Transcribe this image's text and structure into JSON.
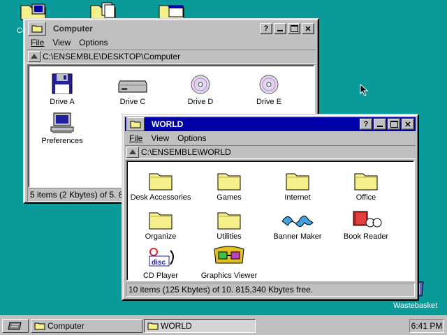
{
  "desktop": {
    "icons": [
      {
        "name": "computer-desktop-icon",
        "label": "Co"
      },
      {
        "name": "documents-desktop-icon",
        "label": ""
      },
      {
        "name": "window-desktop-icon",
        "label": ""
      }
    ],
    "wastebasket_label": "Wastebasket",
    "background_color": "#0a9a9a"
  },
  "computer_window": {
    "title": "Computer",
    "menus": [
      "File",
      "View",
      "Options"
    ],
    "path": "C:\\ENSEMBLE\\DESKTOP\\Computer",
    "items": [
      {
        "label": "Drive A",
        "icon": "floppy-drive-icon"
      },
      {
        "label": "Drive C",
        "icon": "hard-drive-icon"
      },
      {
        "label": "Drive D",
        "icon": "cd-drive-icon"
      },
      {
        "label": "Drive E",
        "icon": "cd-drive-icon"
      },
      {
        "label": "Preferences",
        "icon": "preferences-computer-icon"
      }
    ],
    "status": "5 items (2 Kbytes) of 5.  8"
  },
  "world_window": {
    "title": "WORLD",
    "menus": [
      "File",
      "View",
      "Options"
    ],
    "path": "C:\\ENSEMBLE\\WORLD",
    "items": [
      {
        "label": "Desk Accessories",
        "icon": "folder-icon"
      },
      {
        "label": "Games",
        "icon": "folder-icon"
      },
      {
        "label": "Internet",
        "icon": "folder-icon"
      },
      {
        "label": "Office",
        "icon": "folder-icon"
      },
      {
        "label": "Organize",
        "icon": "folder-icon"
      },
      {
        "label": "Utilities",
        "icon": "folder-icon"
      },
      {
        "label": "Banner Maker",
        "icon": "banner-maker-icon"
      },
      {
        "label": "Book Reader",
        "icon": "book-reader-icon"
      },
      {
        "label": "CD Player",
        "icon": "cd-player-icon"
      },
      {
        "label": "Graphics Viewer",
        "icon": "graphics-viewer-icon"
      }
    ],
    "status": "10 items (125 Kbytes) of 10.  815,340 Kbytes free."
  },
  "taskbar": {
    "tasks": [
      {
        "label": "Computer",
        "active": false
      },
      {
        "label": "WORLD",
        "active": true
      }
    ],
    "clock": "6:41 PM"
  },
  "colors": {
    "active_title": "#0000a8",
    "chrome": "#c0c0c0",
    "folder": "#f6f08a"
  }
}
